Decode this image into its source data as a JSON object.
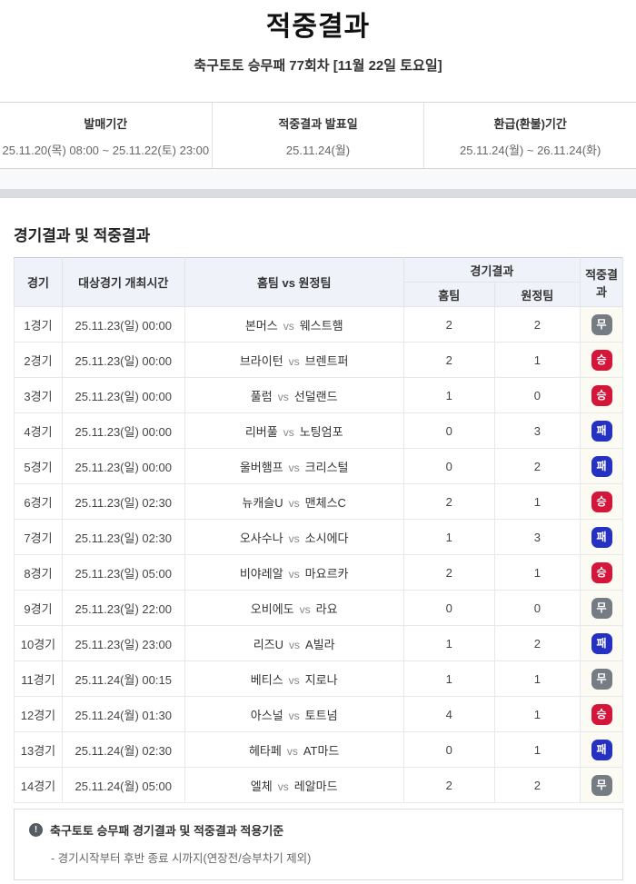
{
  "page": {
    "title": "적중결과",
    "subtitle": "축구토토 승무패 77회차 [11월 22일 토요일]"
  },
  "info_bar": {
    "sale_period": {
      "label": "발매기간",
      "value": "25.11.20(목) 08:00 ~ 25.11.22(토) 23:00"
    },
    "announce_date": {
      "label": "적중결과 발표일",
      "value": "25.11.24(월)"
    },
    "refund_period": {
      "label": "환급(환불)기간",
      "value": "25.11.24(월) ~ 26.11.24(화)"
    }
  },
  "section": {
    "title": "경기결과 및 적중결과"
  },
  "table": {
    "headers": {
      "game": "경기",
      "time": "대상경기 개최시간",
      "match": "홈팀 vs 원정팀",
      "game_result": "경기결과",
      "home": "홈팀",
      "away": "원정팀",
      "hit_result": "적중결과"
    },
    "rows": [
      {
        "no": "1경기",
        "time": "25.11.23(일) 00:00",
        "home_team": "본머스",
        "away_team": "웨스트햄",
        "home_score": "2",
        "away_score": "2",
        "result": "무",
        "result_type": "draw"
      },
      {
        "no": "2경기",
        "time": "25.11.23(일) 00:00",
        "home_team": "브라이턴",
        "away_team": "브렌트퍼",
        "home_score": "2",
        "away_score": "1",
        "result": "승",
        "result_type": "win"
      },
      {
        "no": "3경기",
        "time": "25.11.23(일) 00:00",
        "home_team": "풀럼",
        "away_team": "선덜랜드",
        "home_score": "1",
        "away_score": "0",
        "result": "승",
        "result_type": "win"
      },
      {
        "no": "4경기",
        "time": "25.11.23(일) 00:00",
        "home_team": "리버풀",
        "away_team": "노팅엄포",
        "home_score": "0",
        "away_score": "3",
        "result": "패",
        "result_type": "lose"
      },
      {
        "no": "5경기",
        "time": "25.11.23(일) 00:00",
        "home_team": "울버햄프",
        "away_team": "크리스털",
        "home_score": "0",
        "away_score": "2",
        "result": "패",
        "result_type": "lose"
      },
      {
        "no": "6경기",
        "time": "25.11.23(일) 02:30",
        "home_team": "뉴캐슬U",
        "away_team": "맨체스C",
        "home_score": "2",
        "away_score": "1",
        "result": "승",
        "result_type": "win"
      },
      {
        "no": "7경기",
        "time": "25.11.23(일) 02:30",
        "home_team": "오사수나",
        "away_team": "소시에다",
        "home_score": "1",
        "away_score": "3",
        "result": "패",
        "result_type": "lose"
      },
      {
        "no": "8경기",
        "time": "25.11.23(일) 05:00",
        "home_team": "비야레알",
        "away_team": "마요르카",
        "home_score": "2",
        "away_score": "1",
        "result": "승",
        "result_type": "win"
      },
      {
        "no": "9경기",
        "time": "25.11.23(일) 22:00",
        "home_team": "오비에도",
        "away_team": "라요",
        "home_score": "0",
        "away_score": "0",
        "result": "무",
        "result_type": "draw"
      },
      {
        "no": "10경기",
        "time": "25.11.23(일) 23:00",
        "home_team": "리즈U",
        "away_team": "A빌라",
        "home_score": "1",
        "away_score": "2",
        "result": "패",
        "result_type": "lose"
      },
      {
        "no": "11경기",
        "time": "25.11.24(월) 00:15",
        "home_team": "베티스",
        "away_team": "지로나",
        "home_score": "1",
        "away_score": "1",
        "result": "무",
        "result_type": "draw"
      },
      {
        "no": "12경기",
        "time": "25.11.24(월) 01:30",
        "home_team": "아스널",
        "away_team": "토트넘",
        "home_score": "4",
        "away_score": "1",
        "result": "승",
        "result_type": "win"
      },
      {
        "no": "13경기",
        "time": "25.11.24(월) 02:30",
        "home_team": "헤타페",
        "away_team": "AT마드",
        "home_score": "0",
        "away_score": "1",
        "result": "패",
        "result_type": "lose"
      },
      {
        "no": "14경기",
        "time": "25.11.24(월) 05:00",
        "home_team": "엘체",
        "away_team": "레알마드",
        "home_score": "2",
        "away_score": "2",
        "result": "무",
        "result_type": "draw"
      }
    ]
  },
  "labels": {
    "vs": "vs",
    "notice_icon": "!"
  },
  "colors": {
    "win": "#d4163a",
    "draw": "#767c83",
    "lose": "#2531c2"
  },
  "notice": {
    "title": "축구토토 승무패 경기결과 및 적중결과 적용기준",
    "items": [
      "- 경기시작부터 후반 종료 시까지(연장전/승부차기 제외)"
    ]
  }
}
